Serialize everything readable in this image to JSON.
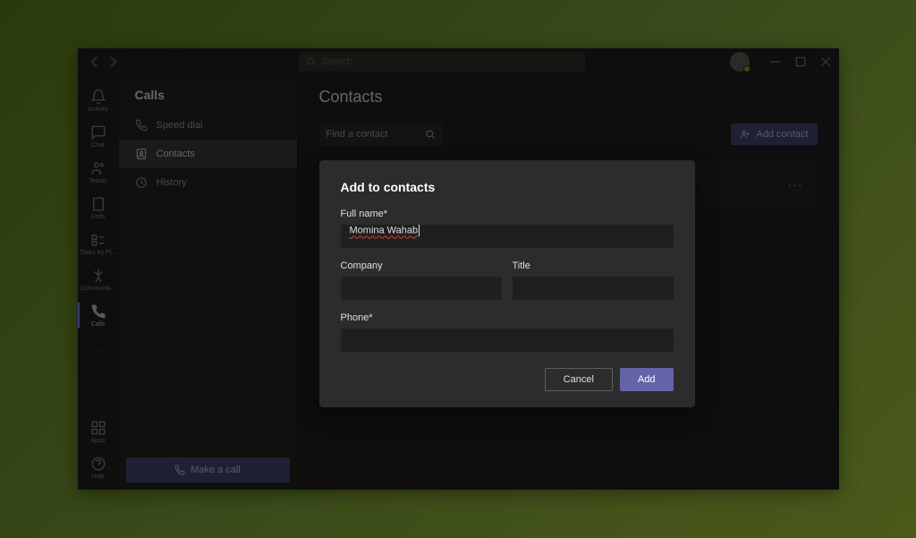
{
  "titlebar": {
    "search_placeholder": "Search"
  },
  "rail": {
    "items": [
      {
        "label": "Activity"
      },
      {
        "label": "Chat"
      },
      {
        "label": "Teams"
      },
      {
        "label": "Units"
      },
      {
        "label": "Tasks by Pl..."
      },
      {
        "label": "Communiti..."
      },
      {
        "label": "Calls"
      }
    ],
    "ellipsis": "···",
    "apps_label": "Apps",
    "help_label": "Help"
  },
  "subnav": {
    "title": "Calls",
    "items": [
      {
        "label": "Speed dial"
      },
      {
        "label": "Contacts"
      },
      {
        "label": "History"
      }
    ],
    "make_call": "Make a call"
  },
  "content": {
    "title": "Contacts",
    "find_placeholder": "Find a contact",
    "add_contact": "Add contact",
    "more": "···"
  },
  "modal": {
    "title": "Add to contacts",
    "fullname_label": "Full name*",
    "fullname_value": "Momina Wahab",
    "company_label": "Company",
    "company_value": "",
    "title_label": "Title",
    "title_value": "",
    "phone_label": "Phone*",
    "phone_value": "",
    "cancel": "Cancel",
    "add": "Add"
  }
}
